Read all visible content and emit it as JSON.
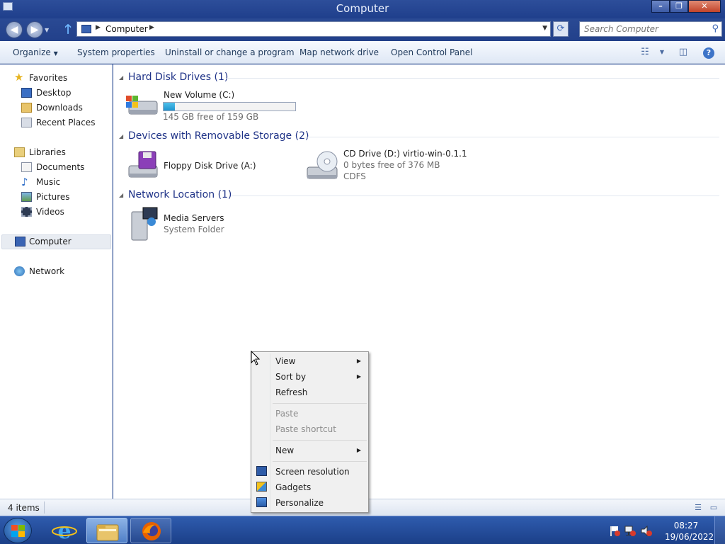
{
  "window": {
    "title": "Computer",
    "controls": {
      "minimize": "–",
      "maximize": "❐",
      "close": "✕"
    }
  },
  "address": {
    "crumbs": [
      "Computer"
    ],
    "search_placeholder": "Search Computer"
  },
  "commands": {
    "organize": "Organize",
    "system_properties": "System properties",
    "uninstall": "Uninstall or change a program",
    "map_drive": "Map network drive",
    "control_panel": "Open Control Panel"
  },
  "nav": {
    "favorites": "Favorites",
    "desktop": "Desktop",
    "downloads": "Downloads",
    "recent_places": "Recent Places",
    "libraries": "Libraries",
    "documents": "Documents",
    "music": "Music",
    "pictures": "Pictures",
    "videos": "Videos",
    "computer": "Computer",
    "network": "Network"
  },
  "groups": {
    "hdd": {
      "header": "Hard Disk Drives (1)",
      "items": [
        {
          "name": "New Volume (C:)",
          "free_text": "145 GB free of 159 GB",
          "used_fraction": 0.088
        }
      ]
    },
    "removable": {
      "header": "Devices with Removable Storage (2)",
      "items": [
        {
          "name": "Floppy Disk Drive (A:)"
        },
        {
          "name": "CD Drive (D:) virtio-win-0.1.1",
          "free_text": "0 bytes free of 376 MB",
          "fs": "CDFS"
        }
      ]
    },
    "network": {
      "header": "Network Location (1)",
      "items": [
        {
          "name": "Media Servers",
          "type": "System Folder"
        }
      ]
    }
  },
  "status": {
    "count": "4 items"
  },
  "context_menu": {
    "view": "View",
    "sort_by": "Sort by",
    "refresh": "Refresh",
    "paste": "Paste",
    "paste_shortcut": "Paste shortcut",
    "new": "New",
    "screen_resolution": "Screen resolution",
    "gadgets": "Gadgets",
    "personalize": "Personalize"
  },
  "taskbar": {
    "time": "08:27",
    "date": "19/06/2022"
  },
  "colors": {
    "accent": "#1e3287",
    "progress": "#1f94cf",
    "taskbar": "#1b3f88"
  }
}
